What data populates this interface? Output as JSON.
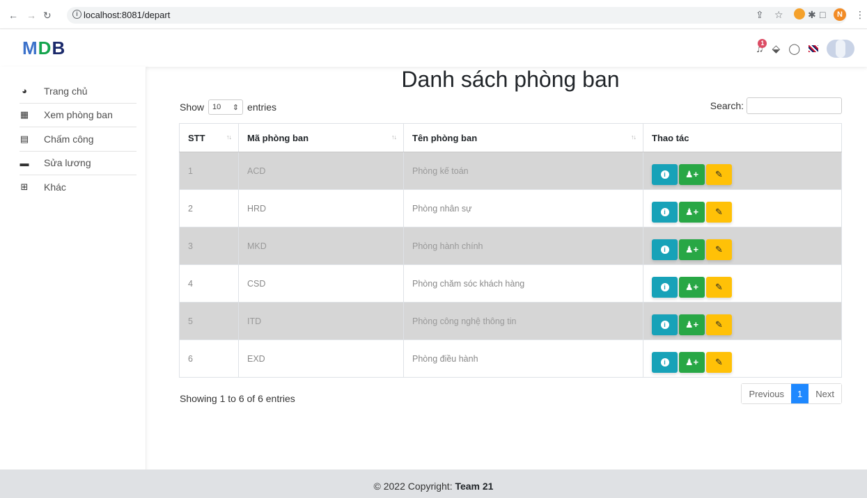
{
  "browser": {
    "url_host": "localhost:8081/depart",
    "profile_initial": "N"
  },
  "header": {
    "logo": {
      "m": "M",
      "d": "D",
      "b": "B"
    },
    "notification_count": "1"
  },
  "sidebar": {
    "items": [
      {
        "label": "Trang chủ",
        "icon": "dashboard-icon",
        "glyph": "◕"
      },
      {
        "label": "Xem phòng ban",
        "icon": "building-icon",
        "glyph": "▦"
      },
      {
        "label": "Chấm công",
        "icon": "calendar-icon",
        "glyph": "▤"
      },
      {
        "label": "Sửa lương",
        "icon": "money-bill-icon",
        "glyph": "▬"
      },
      {
        "label": "Khác",
        "icon": "table-icon",
        "glyph": "⊞"
      }
    ]
  },
  "main": {
    "title": "Danh sách phòng ban",
    "show_label": "Show",
    "entries_value": "10",
    "entries_label": "entries",
    "search_label": "Search:",
    "search_value": "",
    "columns": [
      "STT",
      "Mã phòng ban",
      "Tên phòng ban",
      "Thao tác"
    ],
    "rows": [
      {
        "stt": "1",
        "code": "ACD",
        "name": "Phòng kế toán"
      },
      {
        "stt": "2",
        "code": "HRD",
        "name": "Phòng nhân sự"
      },
      {
        "stt": "3",
        "code": "MKD",
        "name": "Phòng hành chính"
      },
      {
        "stt": "4",
        "code": "CSD",
        "name": "Phòng chăm sóc khách hàng"
      },
      {
        "stt": "5",
        "code": "ITD",
        "name": "Phòng công nghệ thông tin"
      },
      {
        "stt": "6",
        "code": "EXD",
        "name": "Phòng điều hành"
      }
    ],
    "showing_text": "Showing 1 to 6 of 6 entries",
    "pagination": {
      "previous": "Previous",
      "current": "1",
      "next": "Next"
    }
  },
  "footer": {
    "prefix": "© 2022 Copyright: ",
    "team": "Team 21"
  },
  "colors": {
    "info": "#17a2b8",
    "add": "#28a745",
    "edit": "#ffc107",
    "active_page": "#1e88ff",
    "striped_row": "#d6d6d6"
  }
}
